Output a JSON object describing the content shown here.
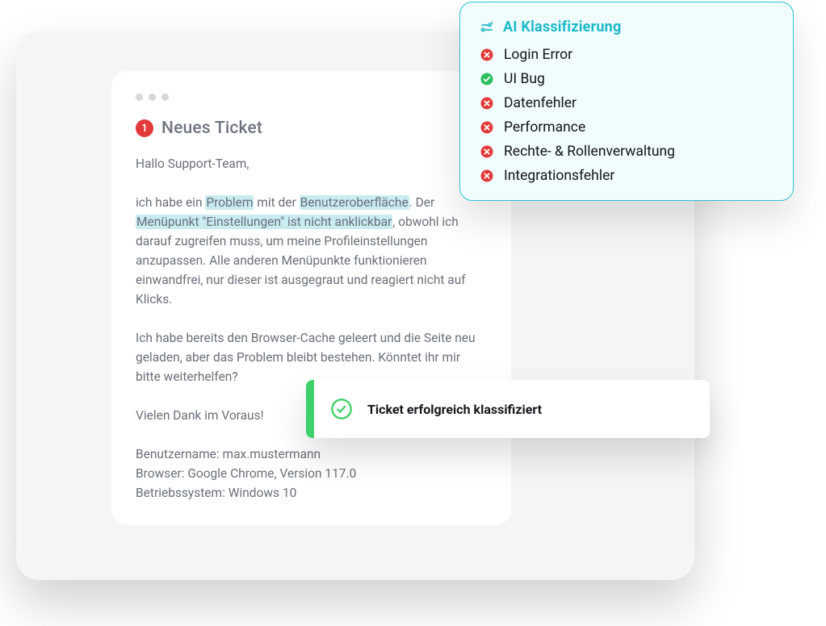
{
  "ticket": {
    "badge": "1",
    "title": "Neues Ticket",
    "greeting": "Hallo Support-Team,",
    "para1_pre": "ich habe ein ",
    "hl1": "Problem",
    "para1_mid": " mit der ",
    "hl2": "Benutzeroberfläche",
    "para1_post1": ". Der ",
    "hl3": "Menüpunkt \"Einstellungen\" ist nicht anklickbar",
    "para1_post2": ", obwohl ich darauf zugreifen muss, um meine Profileinstellungen anzupassen. Alle anderen Menüpunkte funktionieren einwandfrei, nur dieser ist ausgegraut und reagiert nicht auf Klicks.",
    "para2": "Ich habe bereits den Browser-Cache geleert und die Seite neu geladen, aber das Problem bleibt bestehen. Könntet ihr mir bitte weiterhelfen?",
    "thanks": "Vielen Dank im Voraus!",
    "meta1": "Benutzername: max.mustermann",
    "meta2": "Browser: Google Chrome, Version 117.0",
    "meta3": "Betriebssystem: Windows 10"
  },
  "classification": {
    "title": "AI Klassifizierung",
    "items": [
      {
        "label": "Login Error",
        "status": "no"
      },
      {
        "label": "UI Bug",
        "status": "yes"
      },
      {
        "label": "Datenfehler",
        "status": "no"
      },
      {
        "label": "Performance",
        "status": "no"
      },
      {
        "label": "Rechte- & Rollenverwaltung",
        "status": "no"
      },
      {
        "label": "Integrationsfehler",
        "status": "no"
      }
    ]
  },
  "toast": {
    "message": "Ticket erfolgreich klassifiziert"
  }
}
